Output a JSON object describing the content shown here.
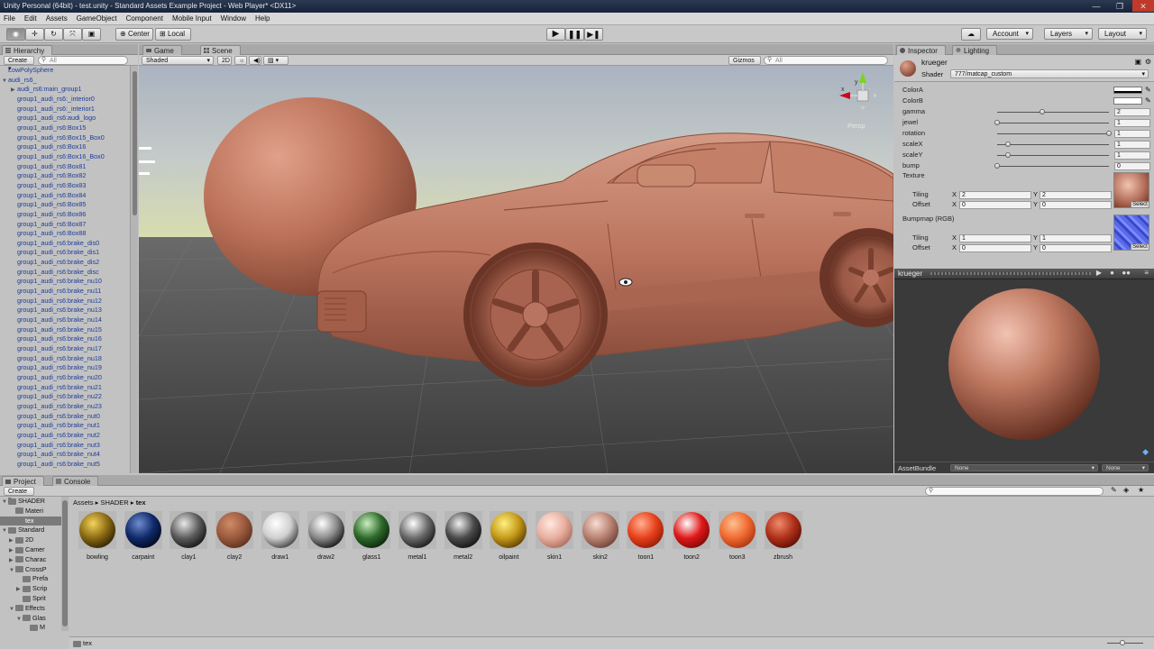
{
  "window": {
    "title": "Unity Personal (64bit) - test.unity - Standard Assets Example Project - Web Player* <DX11>",
    "controls": [
      "—",
      "❐",
      "✕"
    ]
  },
  "menu": [
    "File",
    "Edit",
    "Assets",
    "GameObject",
    "Component",
    "Mobile Input",
    "Window",
    "Help"
  ],
  "toolbar": {
    "pivot": "Center",
    "space": "Local",
    "account": "Account",
    "layers": "Layers",
    "layout": "Layout"
  },
  "hierarchy": {
    "tab": "Hierarchy",
    "create": "Create",
    "search_placeholder": "All",
    "items": [
      {
        "label": "LowPolySphere",
        "indent": 0,
        "arrow": ""
      },
      {
        "label": "audi_rs6_",
        "indent": 0,
        "arrow": "▼"
      },
      {
        "label": "audi_rs6:main_group1",
        "indent": 1,
        "arrow": "▶"
      },
      {
        "label": "group1_audi_rs6:_interior0",
        "indent": 1,
        "arrow": ""
      },
      {
        "label": "group1_audi_rs6:_interior1",
        "indent": 1,
        "arrow": ""
      },
      {
        "label": "group1_audi_rs6:audi_logo",
        "indent": 1,
        "arrow": ""
      },
      {
        "label": "group1_audi_rs6:Box15",
        "indent": 1,
        "arrow": ""
      },
      {
        "label": "group1_audi_rs6:Box15_Box0",
        "indent": 1,
        "arrow": ""
      },
      {
        "label": "group1_audi_rs6:Box16",
        "indent": 1,
        "arrow": ""
      },
      {
        "label": "group1_audi_rs6:Box16_Box0",
        "indent": 1,
        "arrow": ""
      },
      {
        "label": "group1_audi_rs6:Box81",
        "indent": 1,
        "arrow": ""
      },
      {
        "label": "group1_audi_rs6:Box82",
        "indent": 1,
        "arrow": ""
      },
      {
        "label": "group1_audi_rs6:Box83",
        "indent": 1,
        "arrow": ""
      },
      {
        "label": "group1_audi_rs6:Box84",
        "indent": 1,
        "arrow": ""
      },
      {
        "label": "group1_audi_rs6:Box85",
        "indent": 1,
        "arrow": ""
      },
      {
        "label": "group1_audi_rs6:Box86",
        "indent": 1,
        "arrow": ""
      },
      {
        "label": "group1_audi_rs6:Box87",
        "indent": 1,
        "arrow": ""
      },
      {
        "label": "group1_audi_rs6:Box88",
        "indent": 1,
        "arrow": ""
      },
      {
        "label": "group1_audi_rs6:brake_dis0",
        "indent": 1,
        "arrow": ""
      },
      {
        "label": "group1_audi_rs6:brake_dis1",
        "indent": 1,
        "arrow": ""
      },
      {
        "label": "group1_audi_rs6:brake_dis2",
        "indent": 1,
        "arrow": ""
      },
      {
        "label": "group1_audi_rs6:brake_disc",
        "indent": 1,
        "arrow": ""
      },
      {
        "label": "group1_audi_rs6:brake_nu10",
        "indent": 1,
        "arrow": ""
      },
      {
        "label": "group1_audi_rs6:brake_nu11",
        "indent": 1,
        "arrow": ""
      },
      {
        "label": "group1_audi_rs6:brake_nu12",
        "indent": 1,
        "arrow": ""
      },
      {
        "label": "group1_audi_rs6:brake_nu13",
        "indent": 1,
        "arrow": ""
      },
      {
        "label": "group1_audi_rs6:brake_nu14",
        "indent": 1,
        "arrow": ""
      },
      {
        "label": "group1_audi_rs6:brake_nu15",
        "indent": 1,
        "arrow": ""
      },
      {
        "label": "group1_audi_rs6:brake_nu16",
        "indent": 1,
        "arrow": ""
      },
      {
        "label": "group1_audi_rs6:brake_nu17",
        "indent": 1,
        "arrow": ""
      },
      {
        "label": "group1_audi_rs6:brake_nu18",
        "indent": 1,
        "arrow": ""
      },
      {
        "label": "group1_audi_rs6:brake_nu19",
        "indent": 1,
        "arrow": ""
      },
      {
        "label": "group1_audi_rs6:brake_nu20",
        "indent": 1,
        "arrow": ""
      },
      {
        "label": "group1_audi_rs6:brake_nu21",
        "indent": 1,
        "arrow": ""
      },
      {
        "label": "group1_audi_rs6:brake_nu22",
        "indent": 1,
        "arrow": ""
      },
      {
        "label": "group1_audi_rs6:brake_nu23",
        "indent": 1,
        "arrow": ""
      },
      {
        "label": "group1_audi_rs6:brake_nut0",
        "indent": 1,
        "arrow": ""
      },
      {
        "label": "group1_audi_rs6:brake_nut1",
        "indent": 1,
        "arrow": ""
      },
      {
        "label": "group1_audi_rs6:brake_nut2",
        "indent": 1,
        "arrow": ""
      },
      {
        "label": "group1_audi_rs6:brake_nut3",
        "indent": 1,
        "arrow": ""
      },
      {
        "label": "group1_audi_rs6:brake_nut4",
        "indent": 1,
        "arrow": ""
      },
      {
        "label": "group1_audi_rs6:brake_nut5",
        "indent": 1,
        "arrow": ""
      }
    ]
  },
  "scene": {
    "tab_game": "Game",
    "tab_scene": "Scene",
    "shading": "Shaded",
    "mode_2d": "2D",
    "gizmos": "Gizmos",
    "search_placeholder": "All",
    "camera_label": "Persp"
  },
  "inspector": {
    "tab": "Inspector",
    "tab_lighting": "Lighting",
    "material_name": "krueger",
    "shader_label": "Shader",
    "shader_value": "777/matcap_custom",
    "properties": [
      {
        "label": "ColorA",
        "type": "color",
        "color": "#ffffff"
      },
      {
        "label": "ColorB",
        "type": "color",
        "color": "#ffffff"
      },
      {
        "label": "gamma",
        "type": "slider",
        "value": "2",
        "level": 0.4
      },
      {
        "label": "jewel",
        "type": "slider",
        "value": "1",
        "level": 0.0
      },
      {
        "label": "rotation",
        "type": "slider",
        "value": "1",
        "level": 1.0
      },
      {
        "label": "scaleX",
        "type": "slider",
        "value": "1",
        "level": 0.1
      },
      {
        "label": "scaleY",
        "type": "slider",
        "value": "1",
        "level": 0.1
      },
      {
        "label": "bump",
        "type": "slider",
        "value": "0",
        "level": 0.0
      }
    ],
    "texture": {
      "label": "Texture",
      "tiling_label": "Tiling",
      "offset_label": "Offset",
      "tiling_x": "2",
      "tiling_y": "2",
      "offset_x": "0",
      "offset_y": "0",
      "select": "Select"
    },
    "bumpmap": {
      "label": "Bumpmap (RGB)",
      "tiling_label": "Tiling",
      "offset_label": "Offset",
      "tiling_x": "1",
      "tiling_y": "1",
      "offset_x": "0",
      "offset_y": "0",
      "select": "Select"
    },
    "axis_x": "X",
    "axis_y": "Y",
    "preview_title": "krueger",
    "assetbundle_label": "AssetBundle",
    "assetbundle_value": "None",
    "assetbundle_variant": "None"
  },
  "project": {
    "tab": "Project",
    "tab_console": "Console",
    "create": "Create",
    "breadcrumb": [
      "Assets",
      "SHADER",
      "tex"
    ],
    "footer_path": "tex",
    "tree": [
      {
        "label": "SHADER",
        "indent": 1,
        "arrow": "▼",
        "sel": false
      },
      {
        "label": "Materi",
        "indent": 2,
        "arrow": "",
        "sel": false
      },
      {
        "label": "tex",
        "indent": 2,
        "arrow": "",
        "sel": true
      },
      {
        "label": "Standard",
        "indent": 1,
        "arrow": "▼",
        "sel": false
      },
      {
        "label": "2D",
        "indent": 2,
        "arrow": "▶",
        "sel": false
      },
      {
        "label": "Camer",
        "indent": 2,
        "arrow": "▶",
        "sel": false
      },
      {
        "label": "Charac",
        "indent": 2,
        "arrow": "▶",
        "sel": false
      },
      {
        "label": "CrossP",
        "indent": 2,
        "arrow": "▼",
        "sel": false
      },
      {
        "label": "Prefa",
        "indent": 3,
        "arrow": "",
        "sel": false
      },
      {
        "label": "Scrip",
        "indent": 3,
        "arrow": "▶",
        "sel": false
      },
      {
        "label": "Sprit",
        "indent": 3,
        "arrow": "",
        "sel": false
      },
      {
        "label": "Effects",
        "indent": 2,
        "arrow": "▼",
        "sel": false
      },
      {
        "label": "Glas",
        "indent": 3,
        "arrow": "▼",
        "sel": false
      },
      {
        "label": "M",
        "indent": 4,
        "arrow": "",
        "sel": false
      }
    ],
    "materials": [
      {
        "name": "bowling",
        "colors": [
          "#f4d35a",
          "#8a6a14",
          "#2b1e05"
        ]
      },
      {
        "name": "carpaint",
        "colors": [
          "#6f8ccf",
          "#102a6a",
          "#01061a"
        ]
      },
      {
        "name": "clay1",
        "colors": [
          "#e8e8e8",
          "#5c5c5c",
          "#111111"
        ]
      },
      {
        "name": "clay2",
        "colors": [
          "#d08a66",
          "#9a5a3e",
          "#5a2e1c"
        ]
      },
      {
        "name": "draw1",
        "colors": [
          "#ffffff",
          "#cfcfcf",
          "#3a3a3a"
        ]
      },
      {
        "name": "draw2",
        "colors": [
          "#ffffff",
          "#8a8a8a",
          "#0f0f0f"
        ]
      },
      {
        "name": "glass1",
        "colors": [
          "#c8f0c0",
          "#2e6a2a",
          "#0a200a"
        ]
      },
      {
        "name": "metal1",
        "colors": [
          "#ffffff",
          "#6a6a6a",
          "#151515"
        ]
      },
      {
        "name": "metal2",
        "colors": [
          "#f0f0f0",
          "#4a4a4a",
          "#101010"
        ]
      },
      {
        "name": "oilpaint",
        "colors": [
          "#fff080",
          "#c49a18",
          "#5a3a05"
        ]
      },
      {
        "name": "skin1",
        "colors": [
          "#ffe8e0",
          "#e8b0a0",
          "#a86a5a"
        ]
      },
      {
        "name": "skin2",
        "colors": [
          "#f8dcd2",
          "#b88272",
          "#6a3e32"
        ]
      },
      {
        "name": "toon1",
        "colors": [
          "#ffb090",
          "#e8401a",
          "#901a08"
        ]
      },
      {
        "name": "toon2",
        "colors": [
          "#ffffff",
          "#e01818",
          "#7a0808"
        ]
      },
      {
        "name": "toon3",
        "colors": [
          "#ffc090",
          "#f06a30",
          "#a8320e"
        ]
      },
      {
        "name": "zbrush",
        "colors": [
          "#f08a6a",
          "#b0301a",
          "#5a0c04"
        ]
      }
    ]
  },
  "colors": {
    "accent": "#1d3d9a",
    "clay": "#c07a62"
  }
}
